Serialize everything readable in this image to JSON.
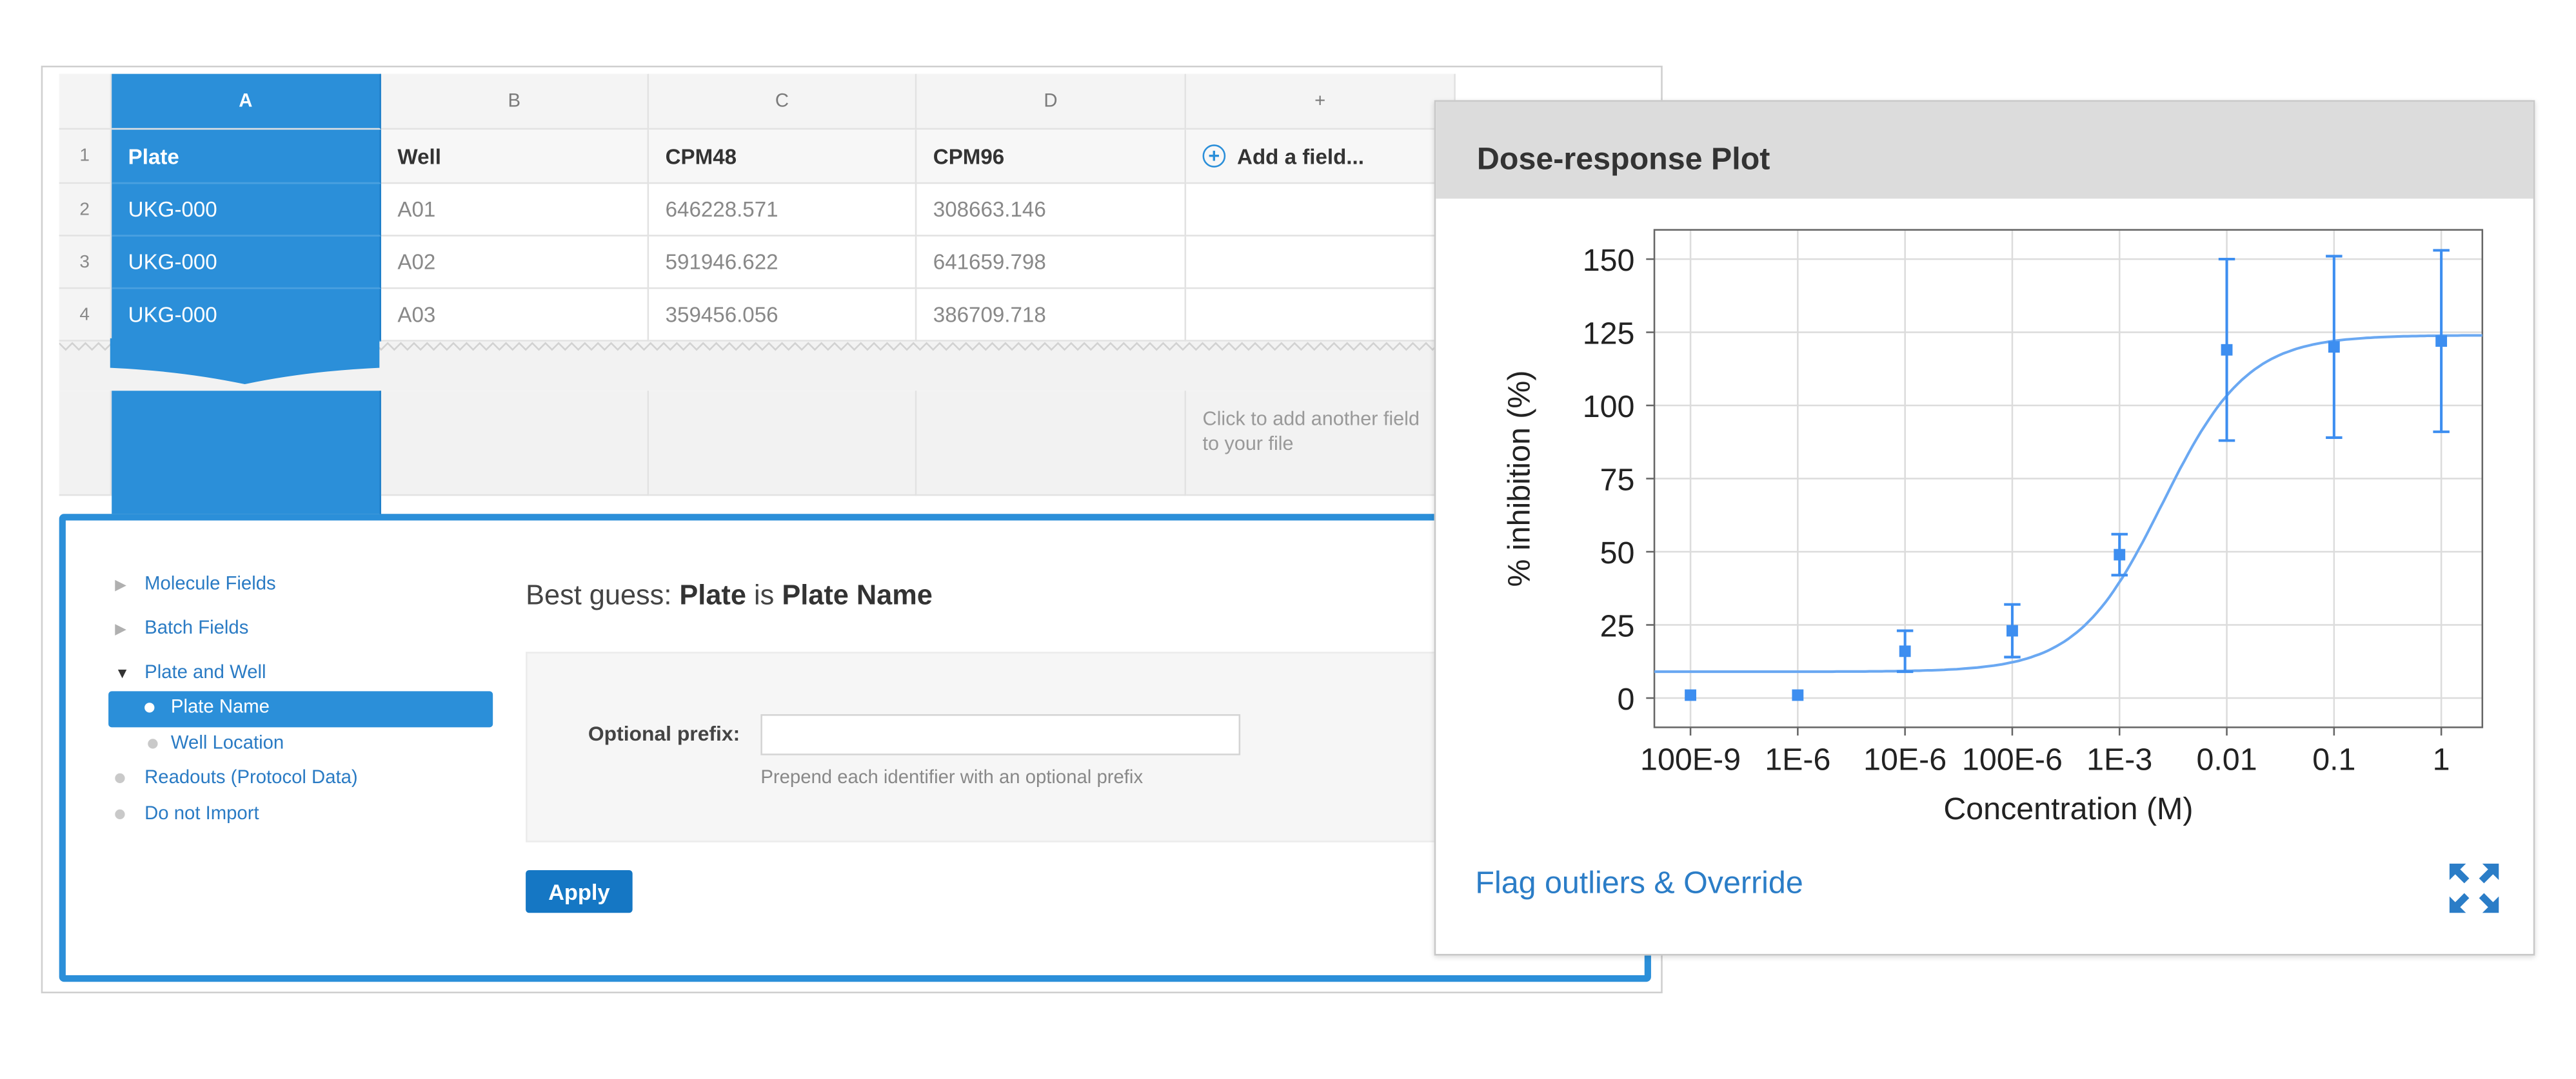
{
  "spreadsheet": {
    "columns": [
      "A",
      "B",
      "C",
      "D",
      "+"
    ],
    "row_numbers": [
      "1",
      "2",
      "3",
      "4"
    ],
    "header_row": [
      "Plate",
      "Well",
      "CPM48",
      "CPM96"
    ],
    "add_field_label": "Add a field...",
    "rows": [
      [
        "UKG-000",
        "A01",
        "646228.571",
        "308663.146"
      ],
      [
        "UKG-000",
        "A02",
        "591946.622",
        "641659.798"
      ],
      [
        "UKG-000",
        "A03",
        "359456.056",
        "386709.718"
      ]
    ],
    "add_field_hint": "Click to add another field to your file"
  },
  "mapping": {
    "tree": {
      "molecule_fields": "Molecule Fields",
      "batch_fields": "Batch Fields",
      "plate_and_well": "Plate and Well",
      "plate_name": "Plate Name",
      "well_location": "Well Location",
      "readouts": "Readouts (Protocol Data)",
      "do_not_import": "Do not Import"
    },
    "best_guess_prefix": "Best guess:",
    "best_guess_field": "Plate",
    "best_guess_is": "is",
    "best_guess_target": "Plate Name",
    "optional_prefix_label": "Optional prefix:",
    "optional_prefix_value": "",
    "optional_prefix_help": "Prepend each identifier with an optional prefix",
    "apply_label": "Apply"
  },
  "plot": {
    "title": "Dose-response Plot",
    "flag_link": "Flag outliers & Override",
    "expand_icon": "expand-arrows-icon",
    "accent_color": "#3d8ef0"
  },
  "chart_data": {
    "type": "scatter",
    "xlabel": "Concentration (M)",
    "ylabel": "% inhibition (%)",
    "x_scale": "log",
    "x_ticks": [
      "100E-9",
      "1E-6",
      "10E-6",
      "100E-6",
      "1E-3",
      "0.01",
      "0.1",
      "1"
    ],
    "x_tick_values": [
      1e-07,
      1e-06,
      1e-05,
      0.0001,
      0.001,
      0.01,
      0.1,
      1
    ],
    "y_ticks": [
      "0",
      "25",
      "50",
      "75",
      "100",
      "125",
      "150"
    ],
    "ylim": [
      -10,
      160
    ],
    "grid": true,
    "series": [
      {
        "points": [
          {
            "x": 1e-07,
            "y": 1,
            "err": 0
          },
          {
            "x": 1e-06,
            "y": 1,
            "err": 0
          },
          {
            "x": 1e-05,
            "y": 16,
            "err": 7
          },
          {
            "x": 0.0001,
            "y": 23,
            "err": 9
          },
          {
            "x": 0.001,
            "y": 49,
            "err": 7
          },
          {
            "x": 0.01,
            "y": 119,
            "err": 31
          },
          {
            "x": 0.1,
            "y": 120,
            "err": 31
          },
          {
            "x": 1,
            "y": 122,
            "err": 31
          }
        ],
        "fit": {
          "bottom": 9,
          "top": 124,
          "log_ec50": -2.6,
          "hill": 1.1
        }
      }
    ]
  }
}
